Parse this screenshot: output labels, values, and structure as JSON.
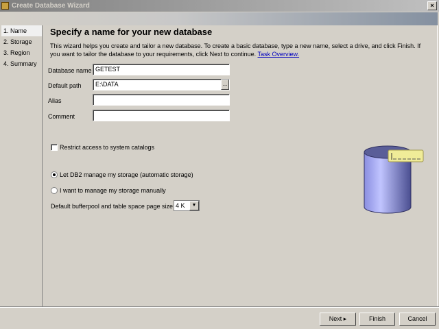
{
  "window": {
    "title": "Create Database Wizard",
    "close": "×"
  },
  "sidebar": {
    "items": [
      {
        "label": "1. Name"
      },
      {
        "label": "2. Storage"
      },
      {
        "label": "3. Region"
      },
      {
        "label": "4. Summary"
      }
    ]
  },
  "main": {
    "heading": "Specify a name for your new database",
    "description": "This wizard helps you create and tailor a new database. To create a basic database, type a new name, select a drive, and click Finish. If you want to tailor the database to your requirements, click Next to continue.",
    "link": "Task Overview.",
    "fields": {
      "database_name": {
        "label": "Database name",
        "value": "GETEST"
      },
      "default_path": {
        "label": "Default path",
        "value": "E:\\DATA",
        "browse": "..."
      },
      "alias": {
        "label": "Alias",
        "value": ""
      },
      "comment": {
        "label": "Comment",
        "value": ""
      }
    },
    "restrict": {
      "label": "Restrict access to system catalogs",
      "checked": false
    },
    "storage": {
      "auto": "Let DB2 manage my storage (automatic storage)",
      "manual": "I want to manage my storage manually",
      "selected": "auto"
    },
    "pagesize": {
      "label": "Default bufferpool and table space page size",
      "value": "4 K"
    }
  },
  "buttons": {
    "next": "Next ▸",
    "finish": "Finish",
    "cancel": "Cancel"
  }
}
